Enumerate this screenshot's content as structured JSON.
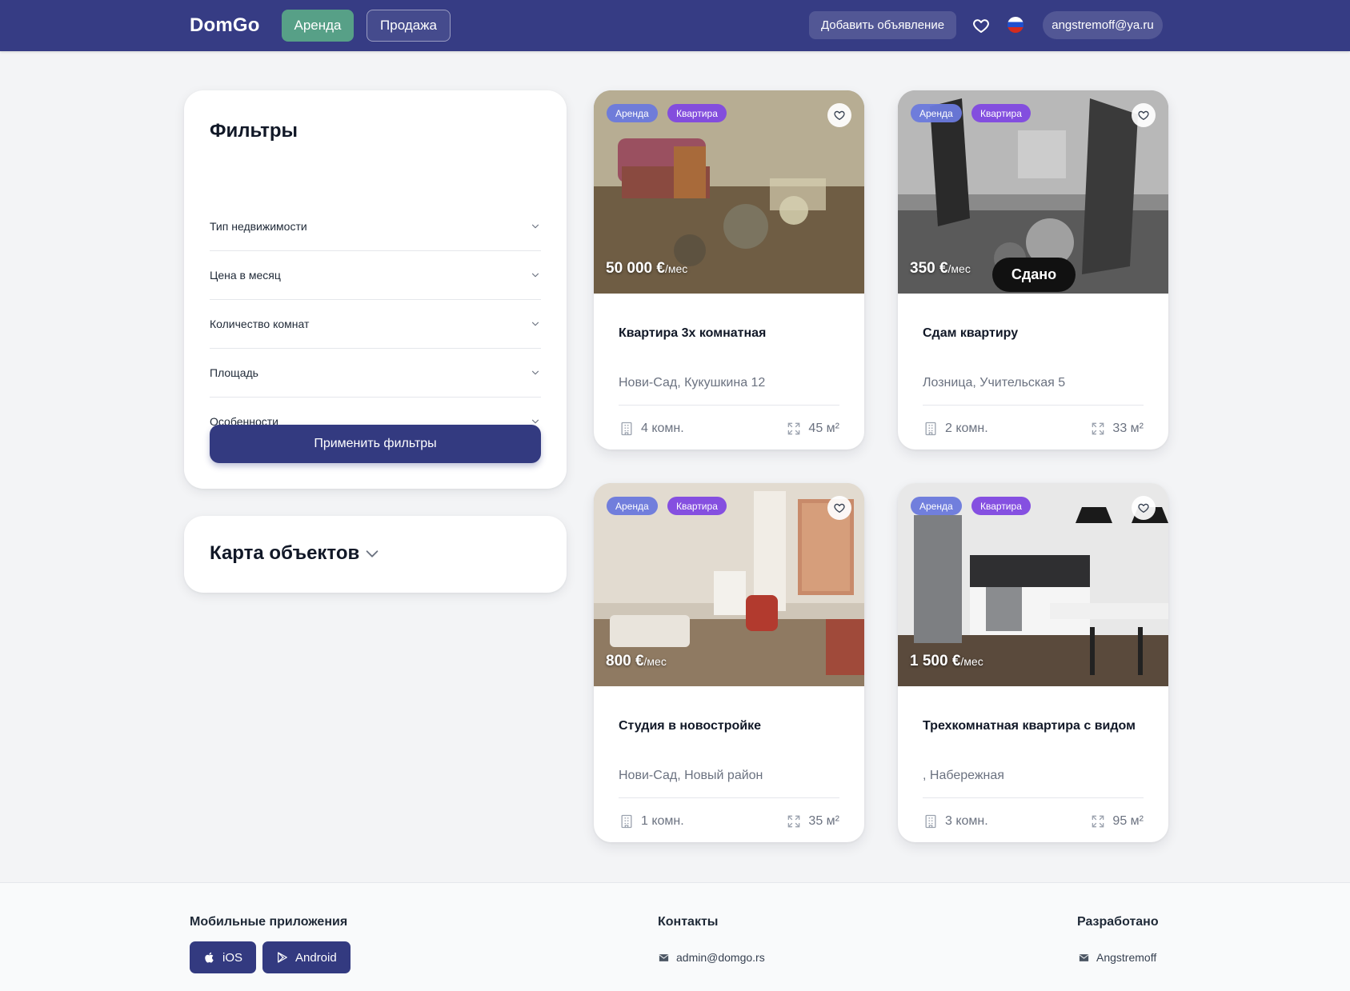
{
  "header": {
    "logo": "DomGo",
    "tab_rent": "Аренда",
    "tab_sale": "Продажа",
    "add_listing": "Добавить объявление",
    "user_email": "angstremoff@ya.ru",
    "icons": [
      "heart-icon",
      "flag-ru-icon"
    ],
    "colors": {
      "bg": "#363c84",
      "active_tab": "#57a087"
    }
  },
  "filters": {
    "title": "Фильтры",
    "items": [
      {
        "label": "Тип недвижимости"
      },
      {
        "label": "Цена в месяц"
      },
      {
        "label": "Количество комнат"
      },
      {
        "label": "Площадь"
      },
      {
        "label": "Особенности"
      }
    ],
    "apply": "Применить фильтры"
  },
  "map": {
    "title": "Карта объектов"
  },
  "listings": [
    {
      "badge_type": "Аренда",
      "badge_kind": "Квартира",
      "price": "50 000 €",
      "price_unit": "/мес",
      "title": "Квартира 3х комнатная",
      "address": "Нови-Сад, Кукушкина 12",
      "rooms": "4 комн.",
      "area": "45 м²",
      "status": ""
    },
    {
      "badge_type": "Аренда",
      "badge_kind": "Квартира",
      "price": "350 €",
      "price_unit": "/мес",
      "title": "Сдам квартиру",
      "address": "Лозница, Учительская 5",
      "rooms": "2 комн.",
      "area": "33 м²",
      "status": "Сдано"
    },
    {
      "badge_type": "Аренда",
      "badge_kind": "Квартира",
      "price": "800 €",
      "price_unit": "/мес",
      "title": "Студия в новостройке",
      "address": "Нови-Сад, Новый район",
      "rooms": "1 комн.",
      "area": "35 м²",
      "status": ""
    },
    {
      "badge_type": "Аренда",
      "badge_kind": "Квартира",
      "price": "1 500 €",
      "price_unit": "/мес",
      "title": "Трехкомнатная квартира с видом",
      "address": ", Набережная",
      "rooms": "3 комн.",
      "area": "95 м²",
      "status": ""
    }
  ],
  "footer": {
    "apps_title": "Мобильные приложения",
    "ios": "iOS",
    "android": "Android",
    "contacts_title": "Контакты",
    "contact_email": "admin@domgo.rs",
    "dev_title": "Разработано",
    "dev_name": "Angstremoff"
  }
}
